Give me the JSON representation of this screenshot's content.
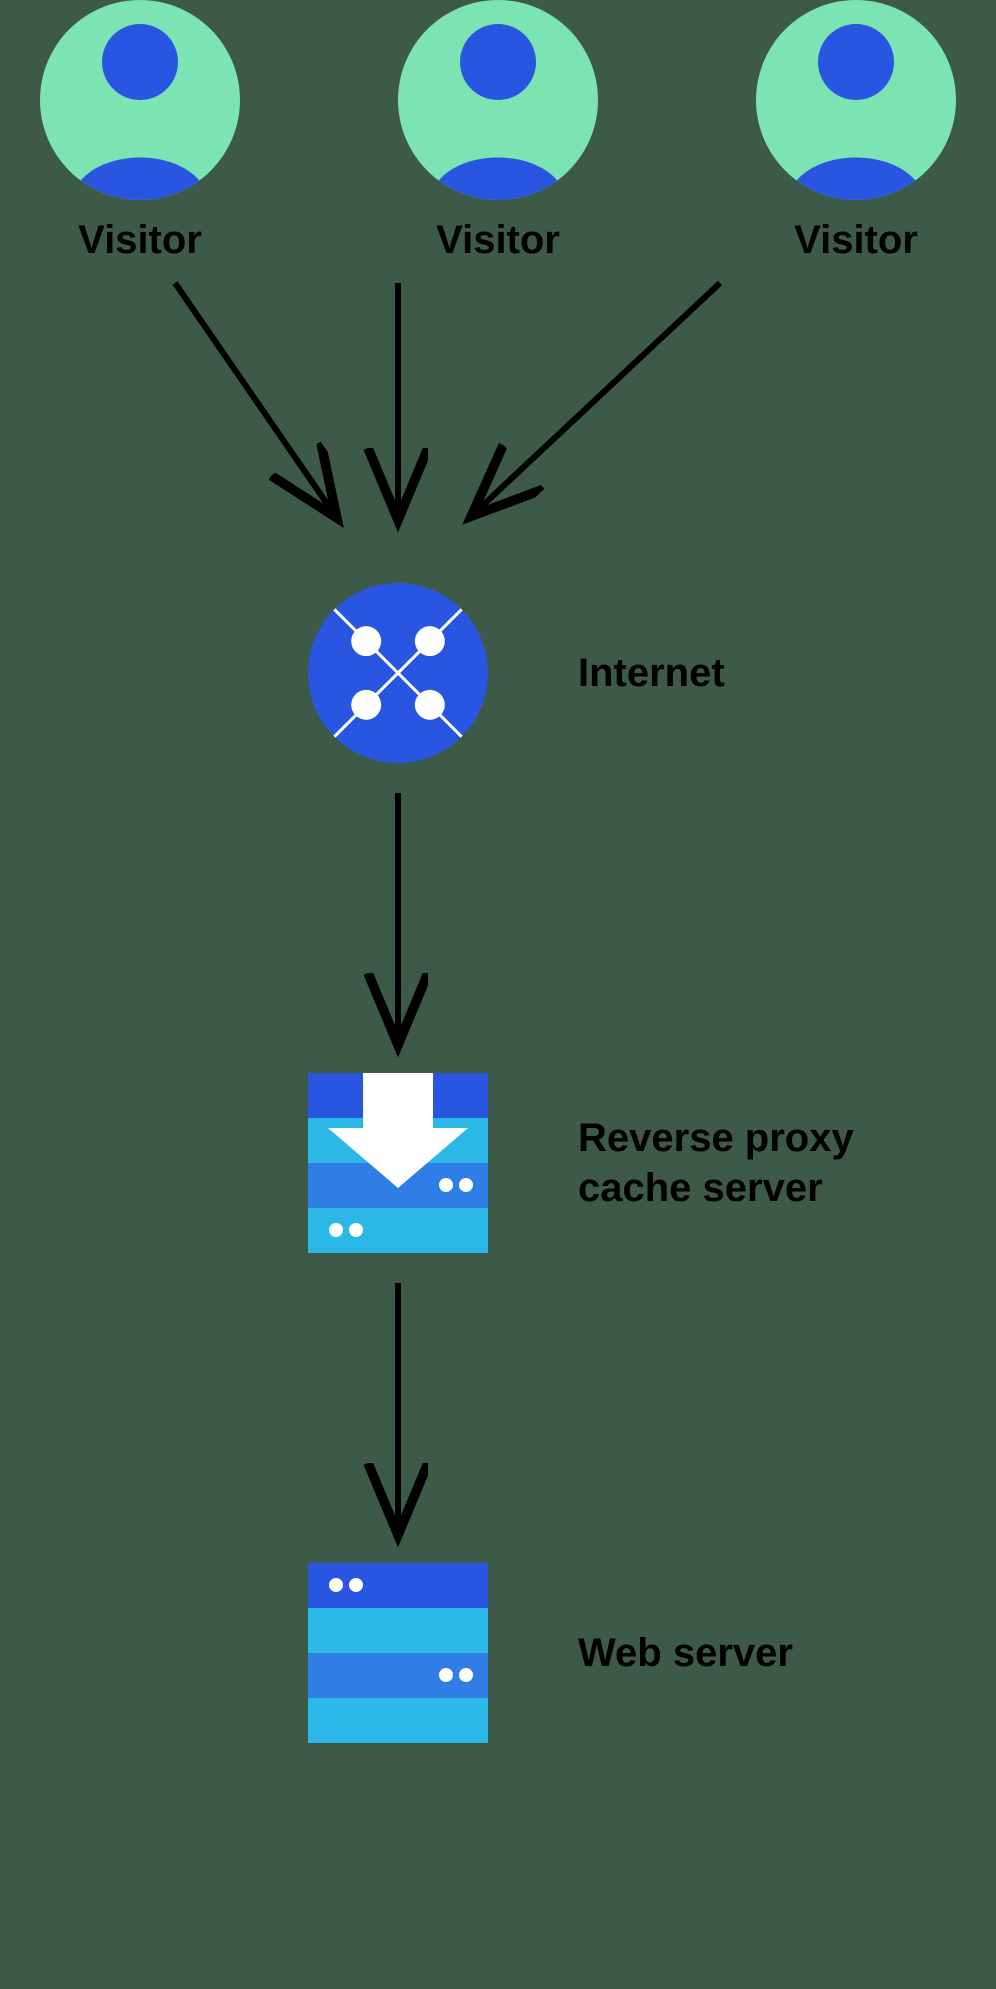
{
  "visitors": {
    "label1": "Visitor",
    "label2": "Visitor",
    "label3": "Visitor"
  },
  "nodes": {
    "internet": "Internet",
    "proxy": "Reverse proxy\ncache server",
    "webserver": "Web server"
  },
  "colors": {
    "mint": "#7ce3b3",
    "blue": "#2956e0",
    "midblue": "#2f7ee6",
    "cyan": "#2bb8e6",
    "darkcyan": "#1f9fd1",
    "white": "#ffffff",
    "stroke": "#000000"
  }
}
